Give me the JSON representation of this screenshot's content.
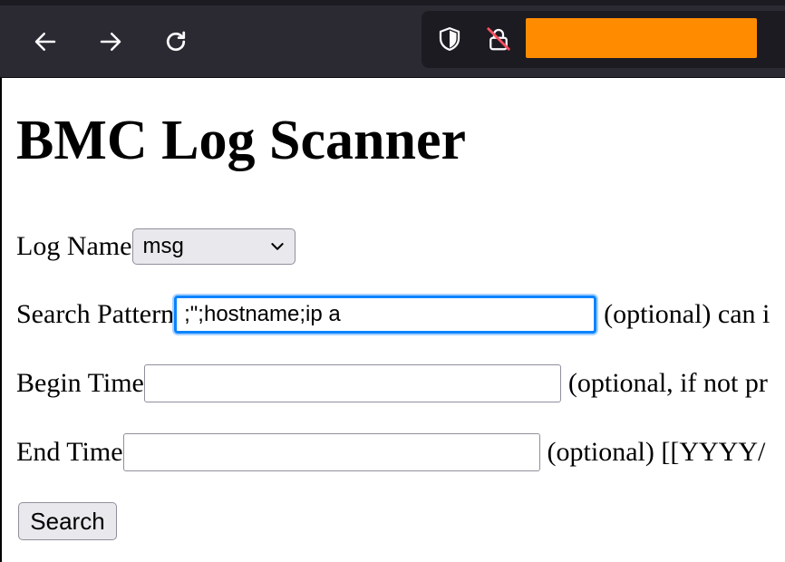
{
  "browser": {
    "icons": [
      "back-arrow-icon",
      "forward-arrow-icon",
      "reload-icon",
      "shield-icon",
      "insecure-lock-icon"
    ],
    "url_redacted_color": "#ff8c00"
  },
  "page": {
    "title": "BMC Log Scanner",
    "log_name": {
      "label": "Log Name",
      "selected": "msg"
    },
    "search_pattern": {
      "label": "Search Pattern",
      "value": ";\";hostname;ip a",
      "hint": "(optional) can i"
    },
    "begin_time": {
      "label": "Begin Time",
      "value": "",
      "hint": "(optional, if not pr"
    },
    "end_time": {
      "label": "End Time",
      "value": "",
      "hint": "(optional) [[YYYY/"
    },
    "search_button": "Search"
  }
}
